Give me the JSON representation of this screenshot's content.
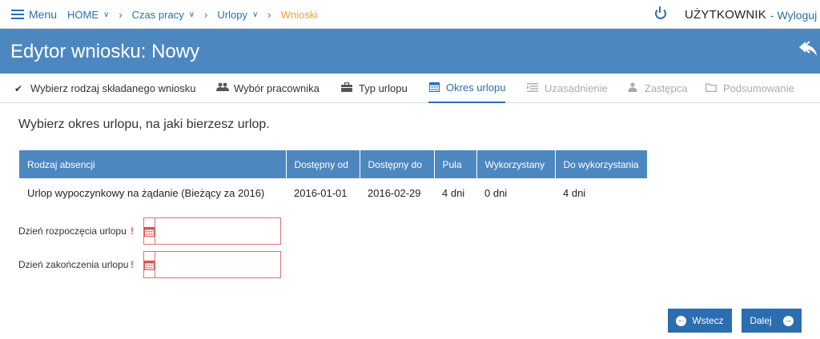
{
  "topnav": {
    "menu_label": "Menu",
    "breadcrumbs": [
      {
        "label": "HOME",
        "has_caret": true
      },
      {
        "label": "Czas pracy",
        "has_caret": true
      },
      {
        "label": "Urlopy",
        "has_caret": true
      },
      {
        "label": "Wnioski",
        "has_caret": false
      }
    ],
    "user": "UŻYTKOWNIK",
    "logout": "- Wyloguj"
  },
  "header": {
    "title": "Edytor wniosku: Nowy"
  },
  "tabs": [
    {
      "label": "Wybierz rodzaj składanego wniosku",
      "icon": "check-icon",
      "state": "done"
    },
    {
      "label": "Wybór pracownika",
      "icon": "users-icon",
      "state": "done"
    },
    {
      "label": "Typ urlopu",
      "icon": "briefcase-icon",
      "state": "done"
    },
    {
      "label": "Okres urlopu",
      "icon": "calendar-icon",
      "state": "active"
    },
    {
      "label": "Uzasadnienie",
      "icon": "text-icon",
      "state": "disabled"
    },
    {
      "label": "Zastępca",
      "icon": "user-icon",
      "state": "disabled"
    },
    {
      "label": "Podsumowanie",
      "icon": "folder-icon",
      "state": "disabled"
    }
  ],
  "instruction": "Wybierz okres urlopu, na jaki bierzesz urlop.",
  "table": {
    "headers": [
      "Rodzaj absencji",
      "Dostępny od",
      "Dostępny do",
      "Pula",
      "Wykorzystany",
      "Do wykorzystania"
    ],
    "rows": [
      [
        "Urlop wypoczynkowy na żądanie (Bieżący za 2016)",
        "2016-01-01",
        "2016-02-29",
        "4 dni",
        "0 dni",
        "4 dni"
      ]
    ]
  },
  "form": {
    "start": {
      "label": "Dzień rozpoczęcia urlopu",
      "required_mark": "!",
      "value": ""
    },
    "end": {
      "label": "Dzień zakończenia urlopu",
      "required_mark": "!",
      "value": ""
    }
  },
  "buttons": {
    "back": "Wstecz",
    "next": "Dalej"
  },
  "colors": {
    "accent": "#2a6db0",
    "header": "#4d87c0",
    "breadcrumb_active": "#f0a024",
    "error": "#e27070"
  }
}
